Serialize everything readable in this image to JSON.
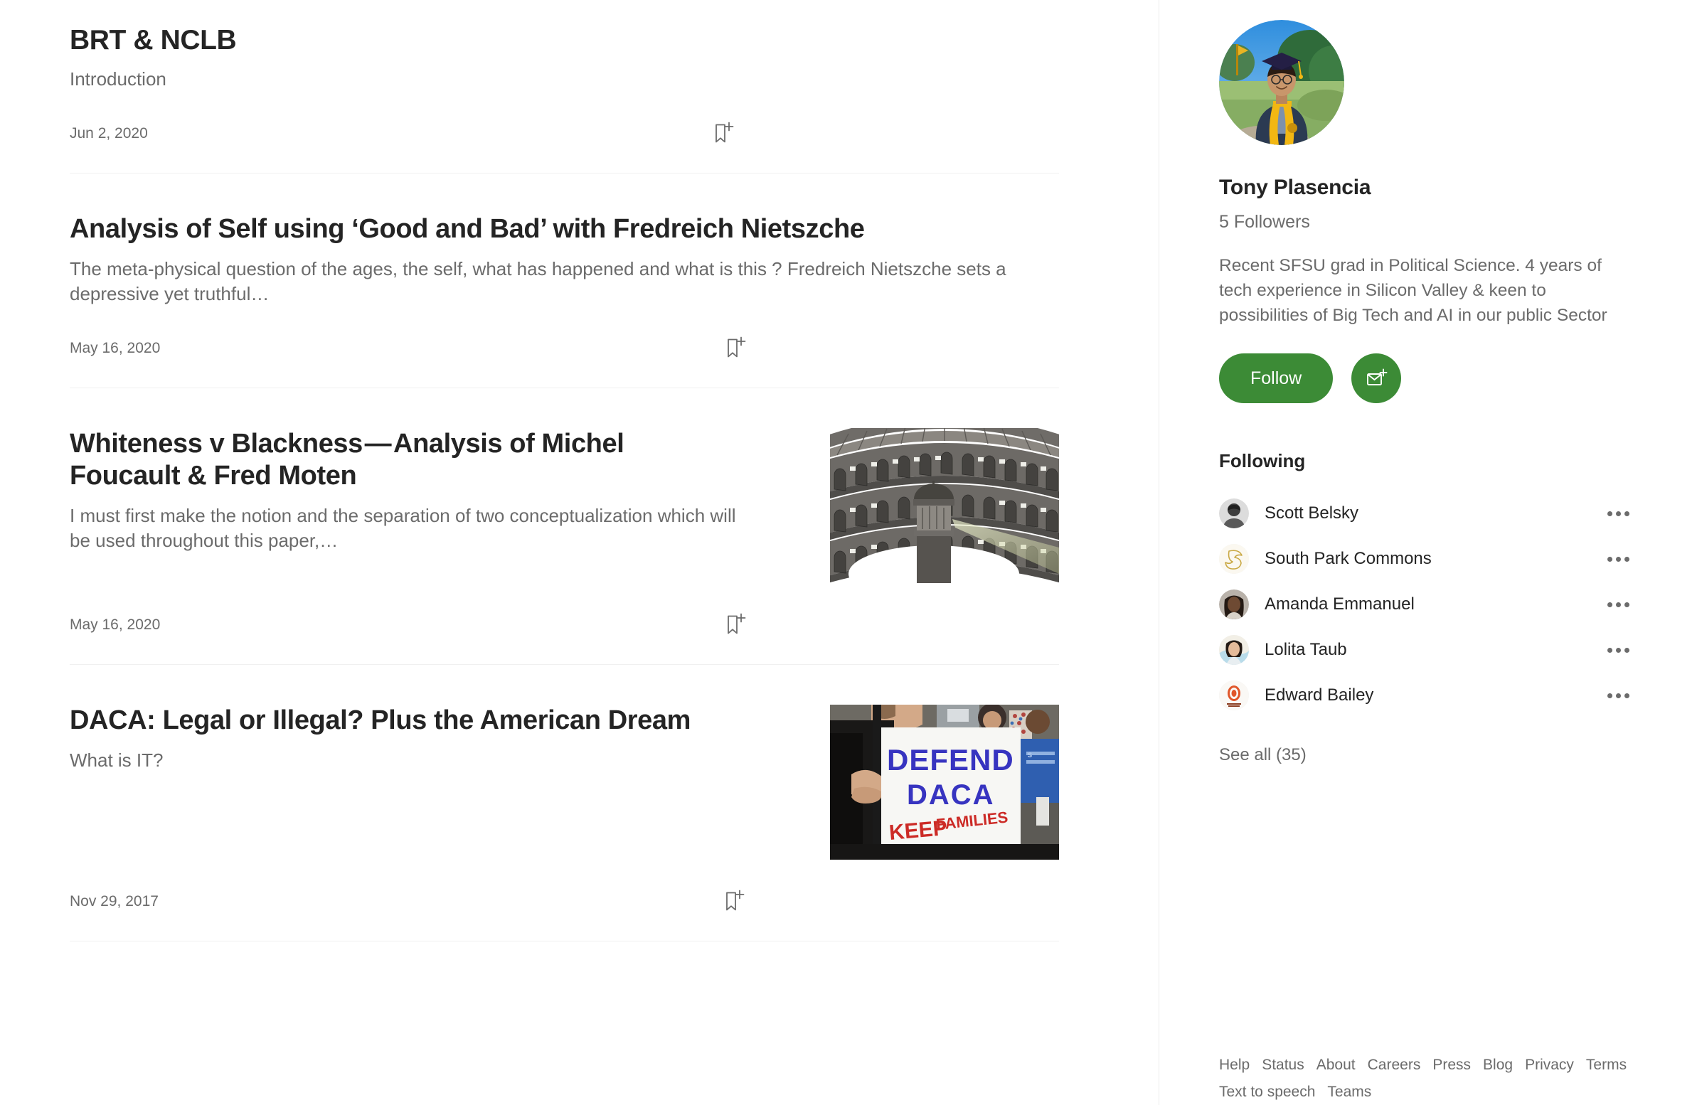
{
  "theme": {
    "accent_green": "#3c8b36",
    "text_primary": "#242424",
    "text_secondary": "#6b6b6b",
    "divider": "#f0f0f0"
  },
  "main": {
    "stories": [
      {
        "title": "BRT & NCLB",
        "subtitle": "Introduction",
        "date": "Jun 2, 2020",
        "has_thumb": false,
        "bookmark_icon": "bookmark-plus-icon"
      },
      {
        "title": "Analysis of Self using ‘Good and Bad’ with Fredreich Nietszche",
        "subtitle": "The meta-physical question of the ages, the self, what has happened and what is this ? Fredreich Nietszche sets a depressive yet truthful…",
        "date": "May 16, 2020",
        "has_thumb": false,
        "bookmark_icon": "bookmark-plus-icon"
      },
      {
        "title": "Whiteness v Blackness — Analysis of Michel Foucault & Fred Moten",
        "subtitle": "I must first make the notion and the separation of two conceptualization which will be used throughout this paper,…",
        "date": "May 16, 2020",
        "has_thumb": true,
        "thumb_name": "panopticon-prison-illustration",
        "bookmark_icon": "bookmark-plus-icon"
      },
      {
        "title": "DACA: Legal or Illegal? Plus the American Dream",
        "subtitle": "What is IT?",
        "date": "Nov 29, 2017",
        "has_thumb": true,
        "thumb_name": "defend-daca-protest-photo",
        "bookmark_icon": "bookmark-plus-icon"
      }
    ]
  },
  "sidebar": {
    "avatar_name": "profile-avatar-graduation-photo",
    "name": "Tony Plasencia",
    "followers": "5 Followers",
    "bio": "Recent SFSU grad in Political Science. 4 years of tech experience in Silicon Valley & keen to possibilities of Big Tech and AI in our public Sector",
    "follow_label": "Follow",
    "mail_icon": "envelope-plus-icon",
    "following_heading": "Following",
    "following": [
      {
        "name": "Scott Belsky",
        "avatar": "avatar-scott-belsky",
        "menu_icon": "more-options-icon"
      },
      {
        "name": "South Park Commons",
        "avatar": "avatar-south-park-commons",
        "menu_icon": "more-options-icon"
      },
      {
        "name": "Amanda Emmanuel",
        "avatar": "avatar-amanda-emmanuel",
        "menu_icon": "more-options-icon"
      },
      {
        "name": "Lolita Taub",
        "avatar": "avatar-lolita-taub",
        "menu_icon": "more-options-icon"
      },
      {
        "name": "Edward Bailey",
        "avatar": "avatar-edward-bailey",
        "menu_icon": "more-options-icon"
      }
    ],
    "see_all": "See all (35)",
    "footer_links_row1": [
      "Help",
      "Status",
      "About",
      "Careers",
      "Press",
      "Blog",
      "Privacy",
      "Terms"
    ],
    "footer_links_row2": [
      "Text to speech",
      "Teams"
    ]
  }
}
